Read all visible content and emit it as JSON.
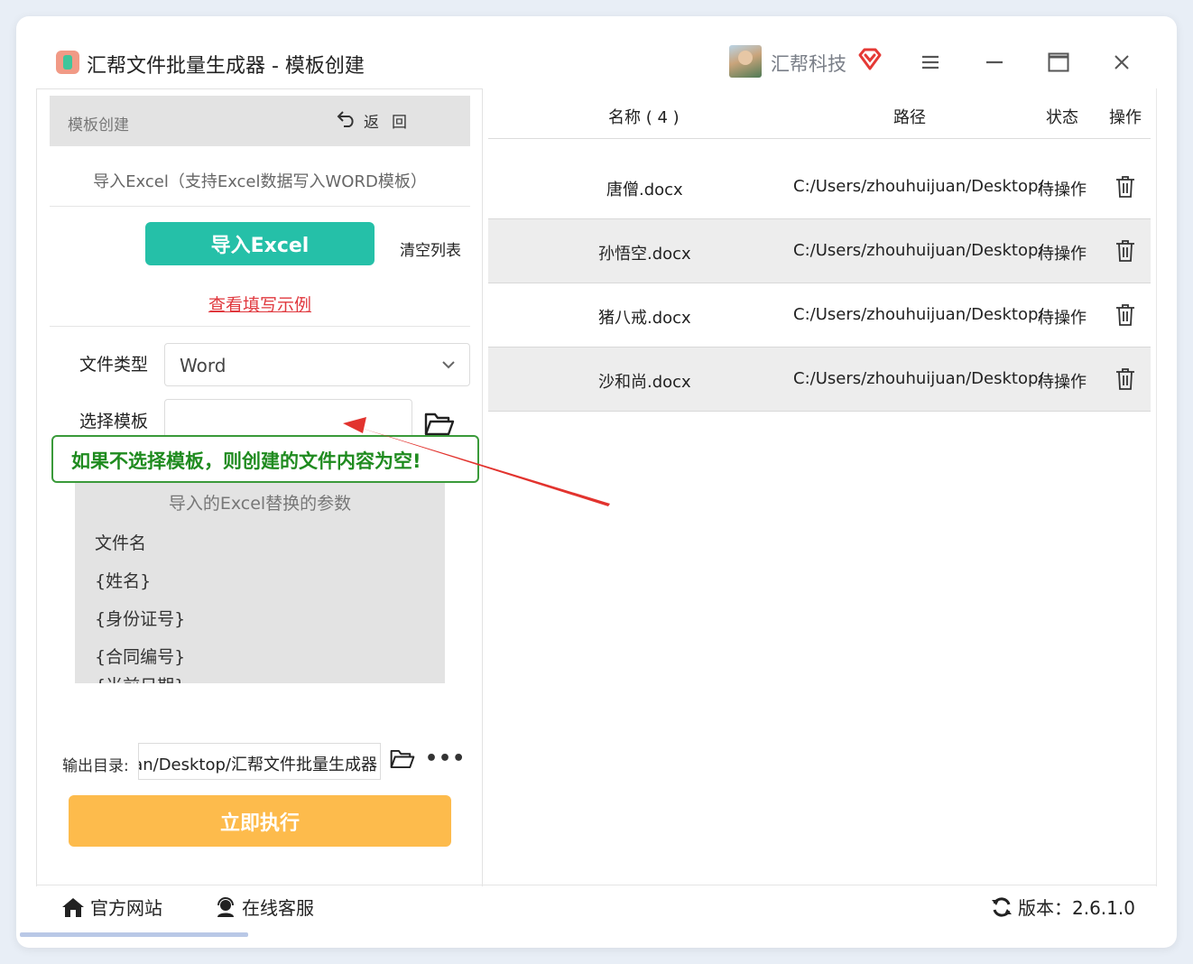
{
  "window": {
    "title": "汇帮文件批量生成器 - 模板创建",
    "brand": "汇帮科技"
  },
  "left_panel": {
    "header_title": "模板创建",
    "back_label": "返回",
    "import_hint": "导入Excel（支持Excel数据写入WORD模板）",
    "import_button": "导入Excel",
    "clear_button": "清空列表",
    "example_link": "查看填写示例",
    "file_type_label": "文件类型",
    "file_type_value": "Word",
    "template_label": "选择模板",
    "template_value": "",
    "callout": "如果不选择模板，则创建的文件内容为空!",
    "params_title": "导入的Excel替换的参数",
    "params": [
      "文件名",
      "{姓名}",
      "{身份证号}",
      "{合同编号}",
      "{当前日期}"
    ],
    "output_label": "输出目录:",
    "output_value": "uan/Desktop/汇帮文件批量生成器",
    "more_label": "•••",
    "run_button": "立即执行"
  },
  "table": {
    "headers": {
      "name": "名称 ( 4 )",
      "path": "路径",
      "status": "状态",
      "action": "操作"
    },
    "rows": [
      {
        "name": "唐僧.docx",
        "path": "C:/Users/zhouhuijuan/Desktop/",
        "status": "待操作"
      },
      {
        "name": "孙悟空.docx",
        "path": "C:/Users/zhouhuijuan/Desktop/",
        "status": "待操作"
      },
      {
        "name": "猪八戒.docx",
        "path": "C:/Users/zhouhuijuan/Desktop/",
        "status": "待操作"
      },
      {
        "name": "沙和尚.docx",
        "path": "C:/Users/zhouhuijuan/Desktop/",
        "status": "待操作"
      }
    ]
  },
  "footer": {
    "website": "官方网站",
    "support": "在线客服",
    "version": "版本：2.6.1.0"
  },
  "colors": {
    "import_button": "#25c0a8",
    "run_button": "#fdbb4c",
    "link": "#e0383e",
    "callout_border": "#3a9a3a",
    "callout_text": "#1f8b1f",
    "arrow": "#e2332e",
    "vip": "#e53935"
  },
  "icons": [
    "app-icon",
    "avatar",
    "vip-icon",
    "menu-icon",
    "minimize-icon",
    "maximize-icon",
    "close-icon",
    "back-icon",
    "chevron-down-icon",
    "folder-icon",
    "trash-icon",
    "home-icon",
    "support-icon",
    "refresh-icon"
  ]
}
